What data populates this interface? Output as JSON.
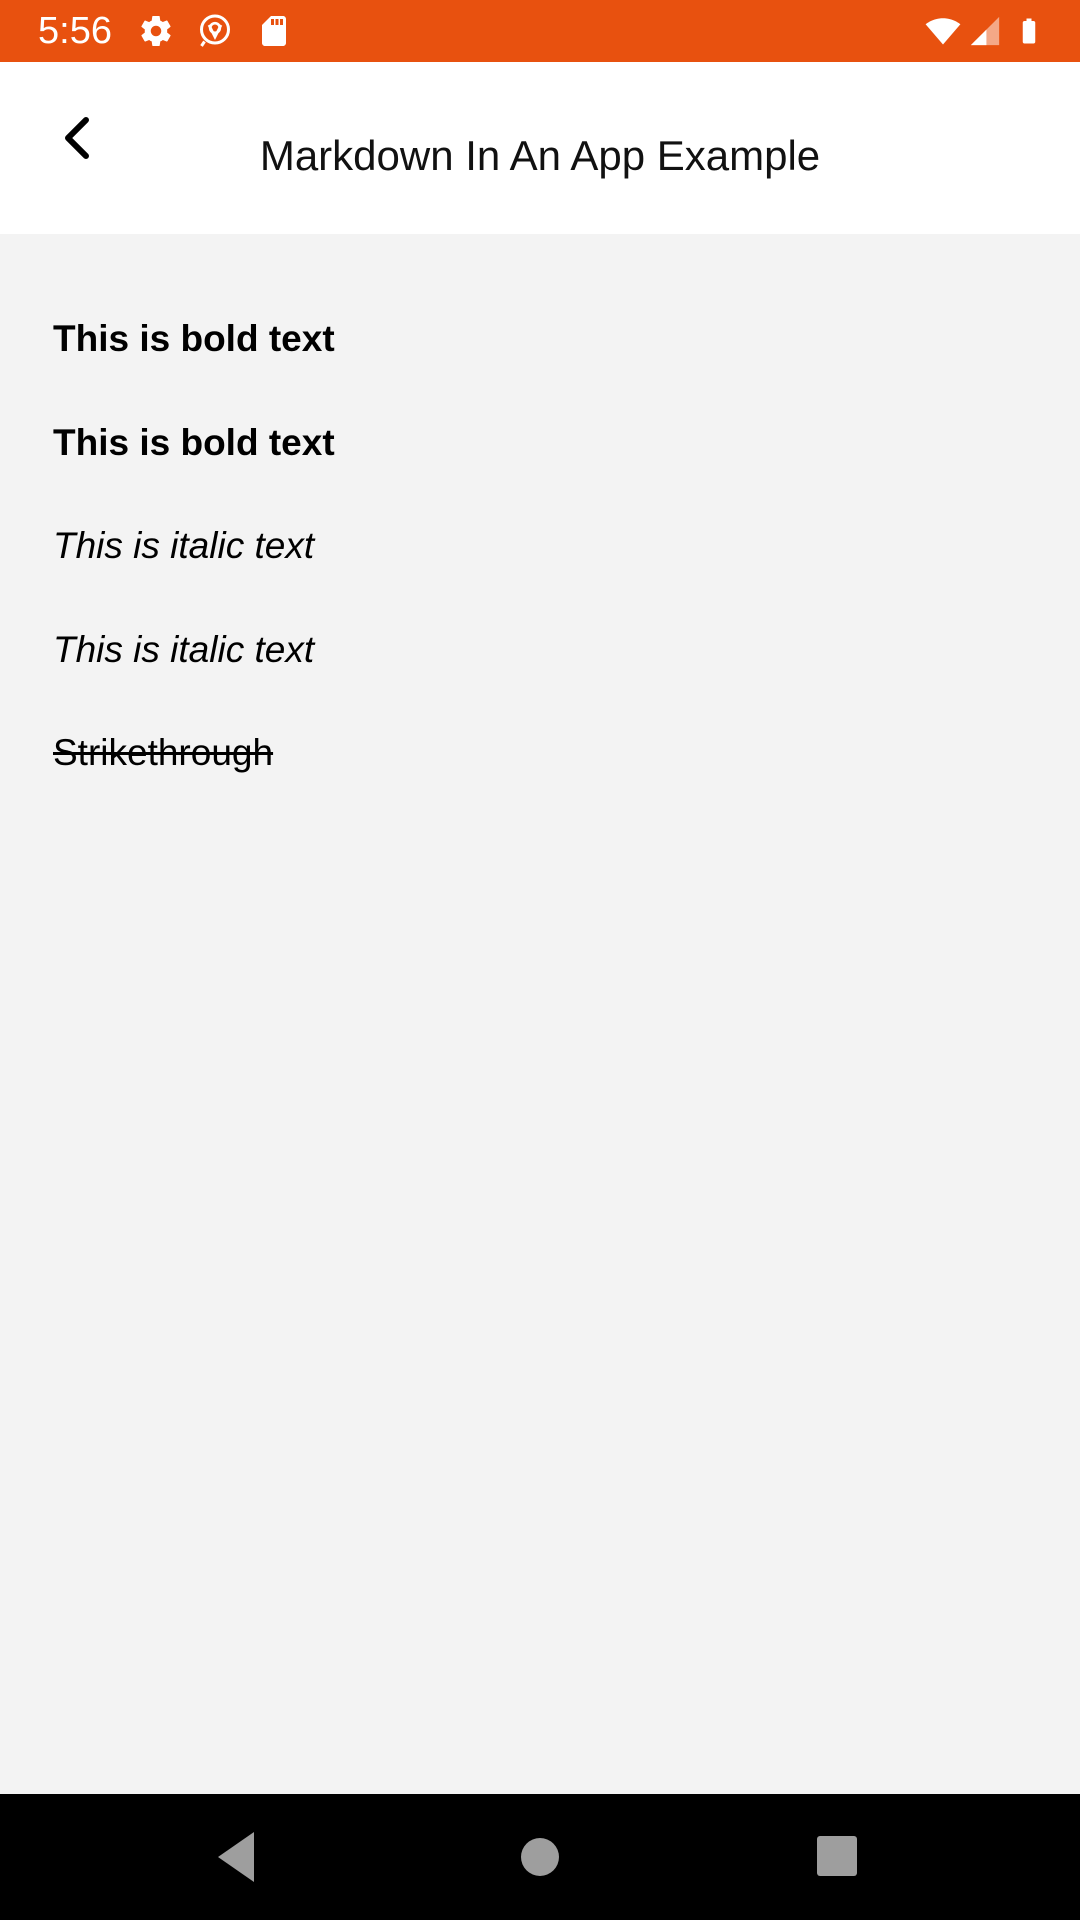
{
  "status_bar": {
    "time": "5:56",
    "background_color": "#e8510f",
    "left_icons": [
      "gear-icon",
      "app-notification-icon",
      "sd-card-icon"
    ],
    "right_icons": [
      "wifi-icon",
      "cell-signal-icon",
      "battery-icon"
    ]
  },
  "app_bar": {
    "title": "Markdown In An App Example",
    "back_icon": "chevron-left-icon"
  },
  "content": {
    "lines": [
      {
        "text": "This is bold text",
        "style": "bold"
      },
      {
        "text": "This is bold text",
        "style": "bold"
      },
      {
        "text": "This is italic text",
        "style": "italic"
      },
      {
        "text": "This is italic text",
        "style": "italic"
      },
      {
        "text": "Strikethrough",
        "style": "strikethrough"
      }
    ]
  },
  "nav_bar": {
    "buttons": [
      "back-triangle-icon",
      "home-circle-icon",
      "recents-square-icon"
    ]
  }
}
